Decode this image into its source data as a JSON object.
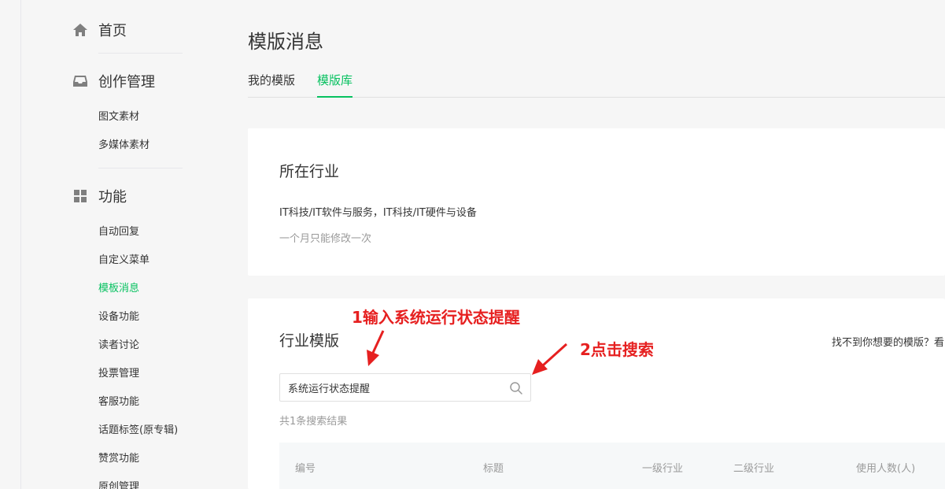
{
  "sidebar": {
    "home": {
      "label": "首页"
    },
    "creation": {
      "label": "创作管理",
      "items": [
        {
          "label": "图文素材"
        },
        {
          "label": "多媒体素材"
        }
      ]
    },
    "features": {
      "label": "功能",
      "items": [
        {
          "label": "自动回复"
        },
        {
          "label": "自定义菜单"
        },
        {
          "label": "模板消息",
          "active": true
        },
        {
          "label": "设备功能"
        },
        {
          "label": "读者讨论"
        },
        {
          "label": "投票管理"
        },
        {
          "label": "客服功能"
        },
        {
          "label": "话题标签(原专辑)"
        },
        {
          "label": "赞赏功能"
        },
        {
          "label": "原创管理"
        }
      ]
    }
  },
  "main": {
    "title": "模版消息",
    "tabs": [
      {
        "label": "我的模版"
      },
      {
        "label": "模版库",
        "active": true
      }
    ],
    "industry_card": {
      "title": "所在行业",
      "industries": "IT科技/IT软件与服务，IT科技/IT硬件与设备",
      "hint": "一个月只能修改一次"
    },
    "template_card": {
      "title": "行业模版",
      "right_link": "找不到你想要的模版？看",
      "search": {
        "value": "系统运行状态提醒",
        "icon": "search-icon"
      },
      "result_count": "共1条搜索结果",
      "table": {
        "columns": [
          "编号",
          "标题",
          "一级行业",
          "二级行业",
          "使用人数(人)"
        ]
      }
    }
  },
  "annotations": {
    "step1": "1输入系统运行状态提醒",
    "step2": "2点击搜索",
    "color": "#e62020"
  },
  "colors": {
    "accent": "#07c160",
    "background": "#f6f6f6"
  }
}
